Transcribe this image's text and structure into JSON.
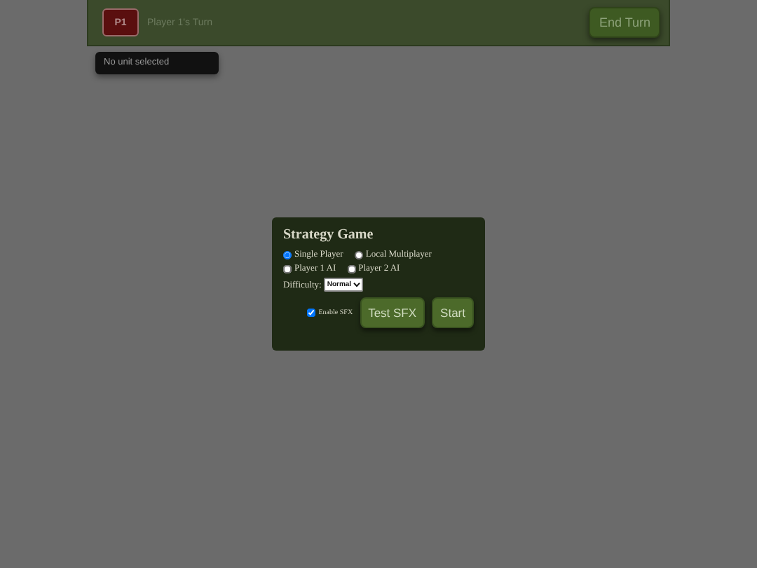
{
  "top_bar": {
    "player_badge": "P1",
    "turn_label": "Player 1's Turn",
    "end_turn_button": "End Turn"
  },
  "unit_info": "No unit selected",
  "dialog": {
    "title": "Strategy Game",
    "modes": [
      {
        "label": "Single Player",
        "selected": true
      },
      {
        "label": "Local Multiplayer",
        "selected": false
      }
    ],
    "ai_options": [
      {
        "label": "Player 1 AI",
        "checked": false
      },
      {
        "label": "Player 2 AI",
        "checked": false
      }
    ],
    "difficulty": {
      "label": "Difficulty:",
      "value": "Normal"
    },
    "sfx": {
      "label": "Enable SFX",
      "checked": true
    },
    "buttons": [
      "Test SFX",
      "Start"
    ]
  }
}
